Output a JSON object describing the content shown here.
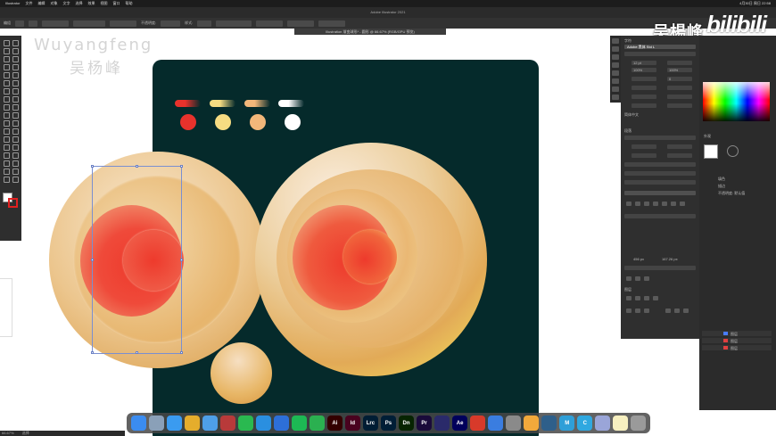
{
  "menubar": {
    "app_name": "Illustrator",
    "items": [
      "文件",
      "编辑",
      "对象",
      "文字",
      "选择",
      "效果",
      "视图",
      "窗口",
      "帮助"
    ],
    "clock": "4月30日 周日 22:58"
  },
  "window": {
    "title": "Adobe Illustrator 2021",
    "document_tab": "Illustration 渐变球形* - 圆形 @ 66.67% (RGB/GPU 预览)"
  },
  "controlbar": {
    "selection_label": "编组",
    "opacity_label": "不透明度:",
    "opacity_value": "100%",
    "style_label": "样式:",
    "zoom": "66.67%"
  },
  "watermark": {
    "english": "Wuyangfeng",
    "chinese": "吴杨峰"
  },
  "brand_overlay": {
    "name_cn": "吴楊峰",
    "site": "bilibili"
  },
  "properties_panel": {
    "font_family": "Adobe 黑体 Std L",
    "font_size": "12 pt",
    "tracking": "0",
    "scale_h": "100%",
    "scale_v": "100%",
    "language": "简体中文",
    "char_label": "字符",
    "para_label": "段落",
    "layers_label": "图层",
    "x_value": "456 px",
    "y_value": "167.26 px"
  },
  "appearance_panel": {
    "title": "外观",
    "fill_label": "填色",
    "stroke_label": "描边",
    "opacity_label": "不透明度: 默认值"
  },
  "layers_panel": {
    "layers": [
      {
        "name": "图层",
        "color": "#4a7cff"
      },
      {
        "name": "图层",
        "color": "#e04040"
      },
      {
        "name": "图层",
        "color": "#e04040"
      }
    ]
  },
  "swatch_colors": {
    "artboard_bg": "#052a2b",
    "red": "#e8322c",
    "yellow": "#f6dc82",
    "orange": "#f2b77a",
    "white": "#ffffff"
  },
  "palette": {
    "gradient_pills": [
      {
        "from": "#e8322c",
        "to": "#052a2b"
      },
      {
        "from": "#f6dc82",
        "to": "#052a2b"
      },
      {
        "from": "#f2b77a",
        "to": "#052a2b"
      },
      {
        "from": "#ffffff",
        "to": "#052a2b"
      }
    ],
    "dots": [
      "#e8322c",
      "#f6dc82",
      "#f2b77a",
      "#ffffff"
    ]
  },
  "dock": {
    "apps": [
      {
        "name": "finder",
        "label": "",
        "color": "#3b8cf0"
      },
      {
        "name": "launchpad",
        "label": "",
        "color": "#8aa0b8"
      },
      {
        "name": "safari",
        "label": "",
        "color": "#3a9bf0"
      },
      {
        "name": "chrome",
        "label": "",
        "color": "#e5ad2c"
      },
      {
        "name": "mail",
        "label": "",
        "color": "#4e9fe8"
      },
      {
        "name": "wechat-work",
        "label": "",
        "color": "#b83a3a"
      },
      {
        "name": "wechat",
        "label": "",
        "color": "#2ab950"
      },
      {
        "name": "qq",
        "label": "",
        "color": "#2a8fe0"
      },
      {
        "name": "vpn",
        "label": "",
        "color": "#2d6fd8"
      },
      {
        "name": "spotify",
        "label": "",
        "color": "#1db954"
      },
      {
        "name": "codeeditor",
        "label": "",
        "color": "#2bb050"
      },
      {
        "name": "illustrator",
        "label": "Ai",
        "color": "#330000"
      },
      {
        "name": "indesign",
        "label": "Id",
        "color": "#49021f"
      },
      {
        "name": "lightroom",
        "label": "Lrc",
        "color": "#001d34"
      },
      {
        "name": "photoshop",
        "label": "Ps",
        "color": "#001e36"
      },
      {
        "name": "dreamweaver",
        "label": "Dn",
        "color": "#072401"
      },
      {
        "name": "premiere",
        "label": "Pr",
        "color": "#1a0a3a"
      },
      {
        "name": "mediaencoder",
        "label": "",
        "color": "#2a2a6a"
      },
      {
        "name": "aftereffects",
        "label": "Ae",
        "color": "#00005b"
      },
      {
        "name": "media",
        "label": "",
        "color": "#d83a2a"
      },
      {
        "name": "cinema",
        "label": "",
        "color": "#3a7de0"
      },
      {
        "name": "settings",
        "label": "",
        "color": "#8a8a8a"
      },
      {
        "name": "sketch",
        "label": "",
        "color": "#f2a93b"
      },
      {
        "name": "blender",
        "label": "",
        "color": "#2e5f8a"
      },
      {
        "name": "maxon",
        "label": "M",
        "color": "#2f9fd8"
      },
      {
        "name": "cloud",
        "label": "C",
        "color": "#2fa8e0"
      },
      {
        "name": "preview",
        "label": "",
        "color": "#9aa5d8"
      },
      {
        "name": "notes",
        "label": "",
        "color": "#f7f0c0"
      },
      {
        "name": "trash",
        "label": "",
        "color": "#9a9a9a"
      }
    ]
  },
  "statusbar": {
    "zoom": "66.67%",
    "tool": "选择"
  }
}
